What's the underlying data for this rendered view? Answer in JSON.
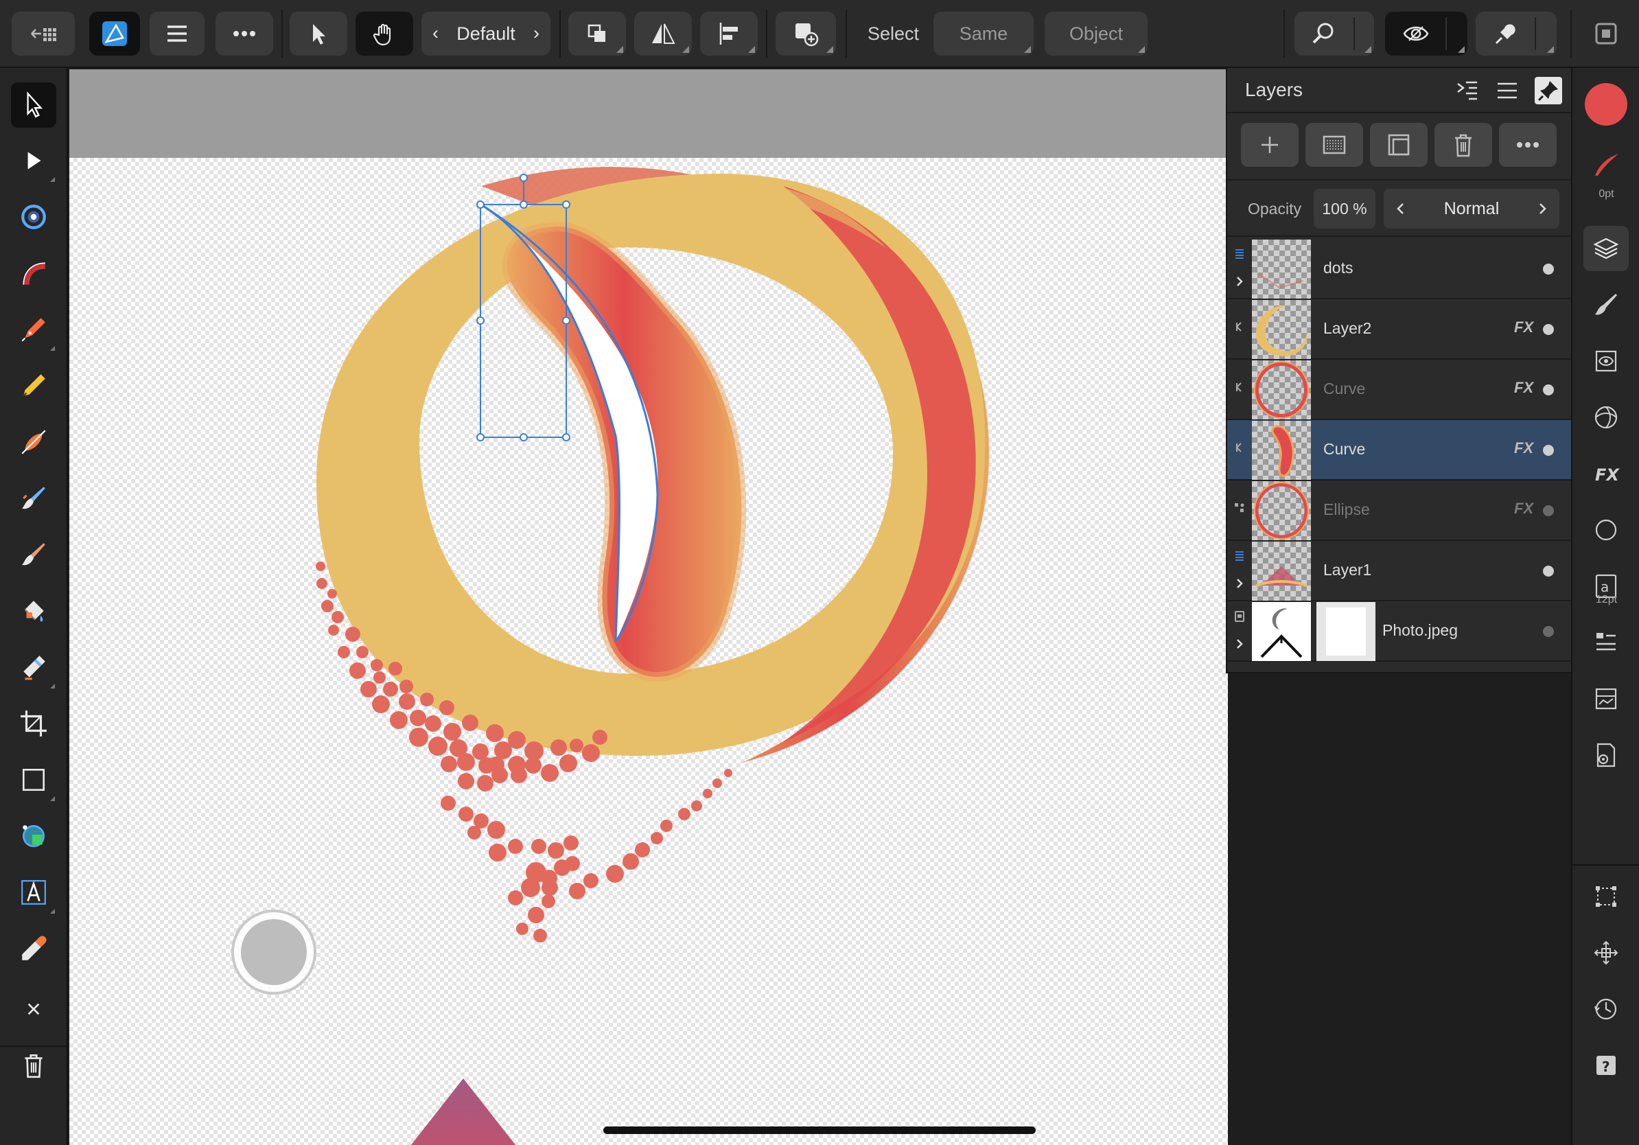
{
  "toolbar": {
    "back_icon": "back-grid-icon",
    "persona_icon": "designer-persona-icon",
    "menu_icon": "hamburger-icon",
    "more_icon": "more-icon",
    "move_tool_icon": "pointer-icon",
    "hand_icon": "hand-icon",
    "style_label": "Default",
    "arrange_icon": "arrange-icon",
    "flip_icon": "flip-icon",
    "align_icon": "align-icon",
    "add_shape_icon": "add-shape-icon",
    "select_label": "Select",
    "same_label": "Same",
    "object_label": "Object",
    "zoom_icon": "zoom-icon",
    "view_icon": "view-mode-icon",
    "snapping_icon": "snapping-icon",
    "window_icon": "window-icon"
  },
  "left_tools": [
    {
      "name": "move-tool",
      "icon": "pointer-icon",
      "active": true
    },
    {
      "name": "node-tool",
      "icon": "node-pointer-icon"
    },
    {
      "name": "corner-tool",
      "icon": "corner-icon"
    },
    {
      "name": "brush-tool",
      "icon": "vector-brush-icon"
    },
    {
      "name": "pen-tool",
      "icon": "pen-icon"
    },
    {
      "name": "pencil-tool",
      "icon": "pencil-icon"
    },
    {
      "name": "fill-tool",
      "icon": "fill-icon"
    },
    {
      "name": "paint-brush-tool",
      "icon": "paint-brush-icon"
    },
    {
      "name": "pixel-brush-tool",
      "icon": "pixel-brush-icon"
    },
    {
      "name": "flood-fill-tool",
      "icon": "bucket-icon"
    },
    {
      "name": "erase-tool",
      "icon": "eraser-icon"
    },
    {
      "name": "crop-tool",
      "icon": "crop-icon"
    },
    {
      "name": "rectangle-tool",
      "icon": "rectangle-icon"
    },
    {
      "name": "shape-tool",
      "icon": "shape-builder-icon"
    },
    {
      "name": "text-tool",
      "icon": "text-icon"
    },
    {
      "name": "color-picker-tool",
      "icon": "eyedropper-icon"
    }
  ],
  "context_actions": {
    "close_icon": "close-icon",
    "delete_icon": "trash-icon"
  },
  "layers_panel": {
    "title": "Layers",
    "opacity_label": "Opacity",
    "opacity_value": "100 %",
    "blend_mode": "Normal",
    "layers": [
      {
        "name": "dots",
        "fx": false,
        "dim": false,
        "type": "layer",
        "selected": false
      },
      {
        "name": "Layer2",
        "fx": true,
        "dim": false,
        "type": "child",
        "selected": false
      },
      {
        "name": "Curve",
        "fx": true,
        "dim": true,
        "type": "child",
        "selected": false
      },
      {
        "name": "Curve",
        "fx": true,
        "dim": false,
        "type": "child",
        "selected": true
      },
      {
        "name": "Ellipse",
        "fx": true,
        "dim": true,
        "type": "child",
        "selected": false
      },
      {
        "name": "Layer1",
        "fx": false,
        "dim": false,
        "type": "layer",
        "selected": false
      },
      {
        "name": "Photo.jpeg",
        "fx": false,
        "dim": false,
        "type": "pixel",
        "selected": false
      }
    ],
    "fx_label": "FX"
  },
  "studio": {
    "stroke_width_label": "0pt",
    "text_size_label": "12pt",
    "fill_color": "#e24c4c",
    "stroke_color": "#d8463f"
  },
  "colors": {
    "selection": "#324a66",
    "accent_blue": "#3b7dd8",
    "ring_yellow": "#e8bf69",
    "ring_red": "#e14b4b",
    "dots": "#e26a5d"
  }
}
